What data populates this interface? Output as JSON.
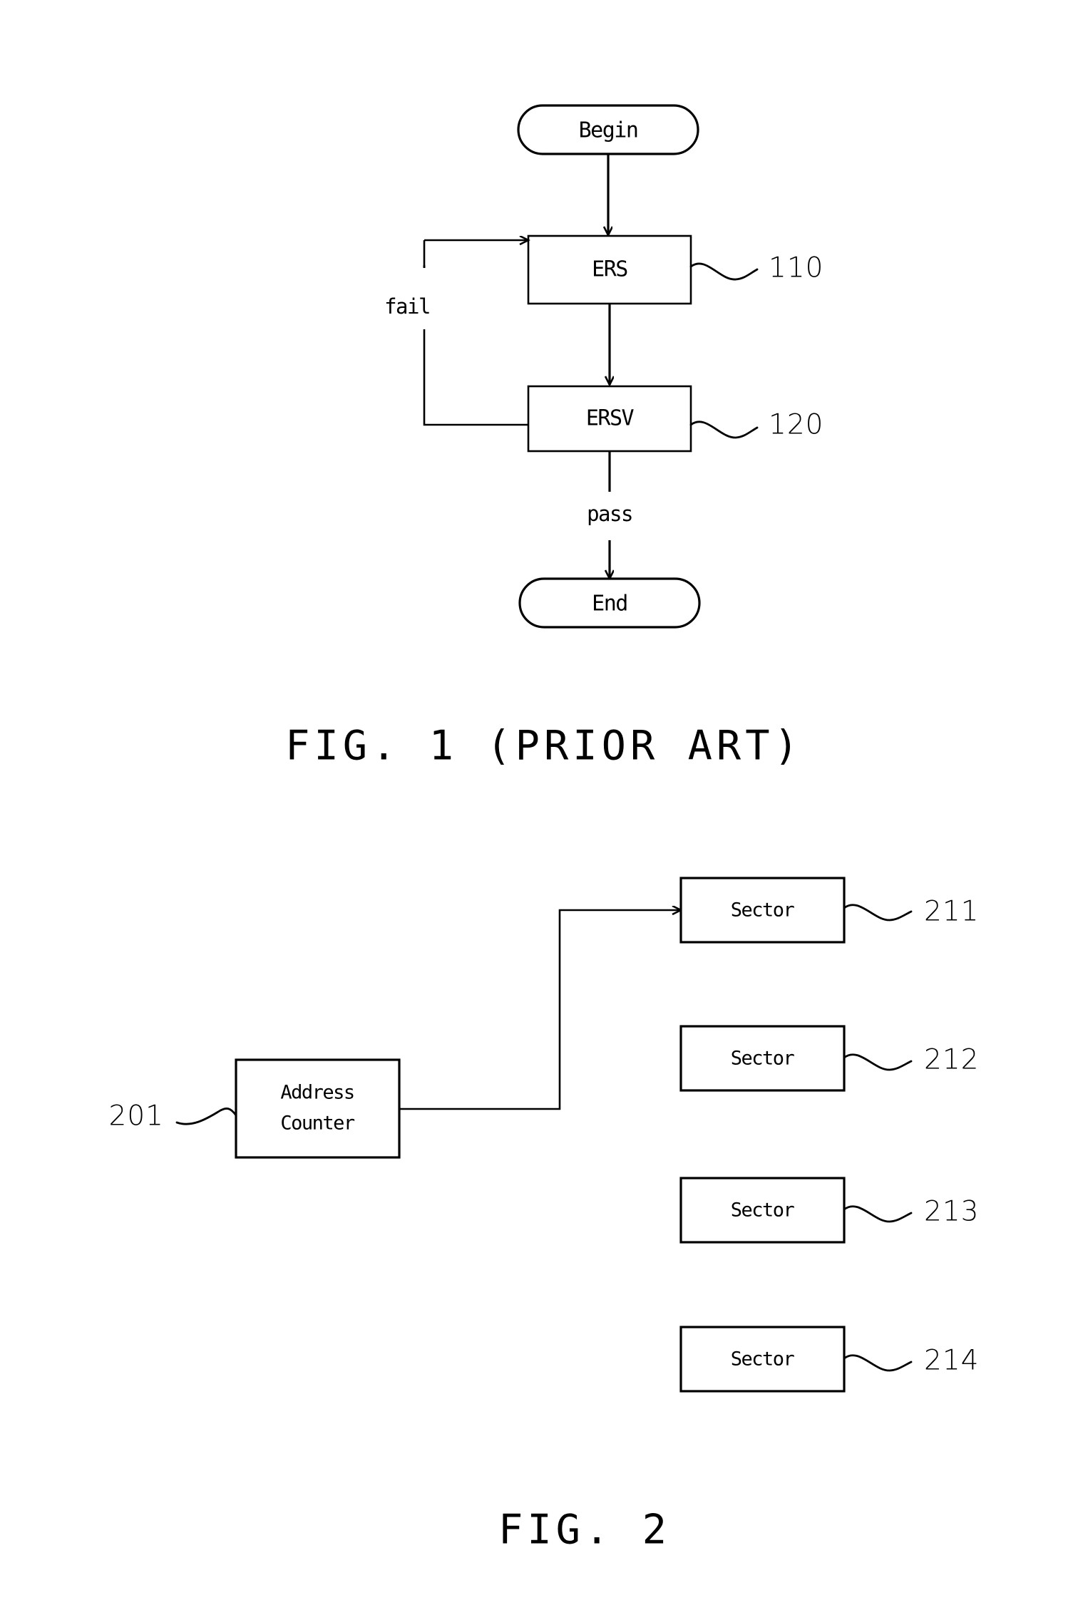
{
  "document": {
    "type": "patent-figure-sheet",
    "background_color": "#ffffff",
    "line_color": "#000000"
  },
  "figure1": {
    "caption": "FIG. 1 (PRIOR ART)",
    "nodes": {
      "begin": {
        "label": "Begin",
        "shape": "stadium"
      },
      "ers": {
        "label": "ERS",
        "shape": "rect",
        "ref": "110"
      },
      "ersv": {
        "label": "ERSV",
        "shape": "rect",
        "ref": "120"
      },
      "end": {
        "label": "End",
        "shape": "stadium"
      }
    },
    "edge_labels": {
      "fail": "fail",
      "pass": "pass"
    },
    "reference_numerals": {
      "ers_ref": "110",
      "ersv_ref": "120"
    }
  },
  "figure2": {
    "caption": "FIG. 2",
    "nodes": {
      "address_counter": {
        "label_line1": "Address",
        "label_line2": "Counter",
        "ref": "201"
      },
      "sectors": [
        {
          "label": "Sector",
          "ref": "211"
        },
        {
          "label": "Sector",
          "ref": "212"
        },
        {
          "label": "Sector",
          "ref": "213"
        },
        {
          "label": "Sector",
          "ref": "214"
        }
      ]
    },
    "reference_numerals": {
      "address_counter_ref": "201",
      "sector_refs": [
        "211",
        "212",
        "213",
        "214"
      ]
    }
  }
}
